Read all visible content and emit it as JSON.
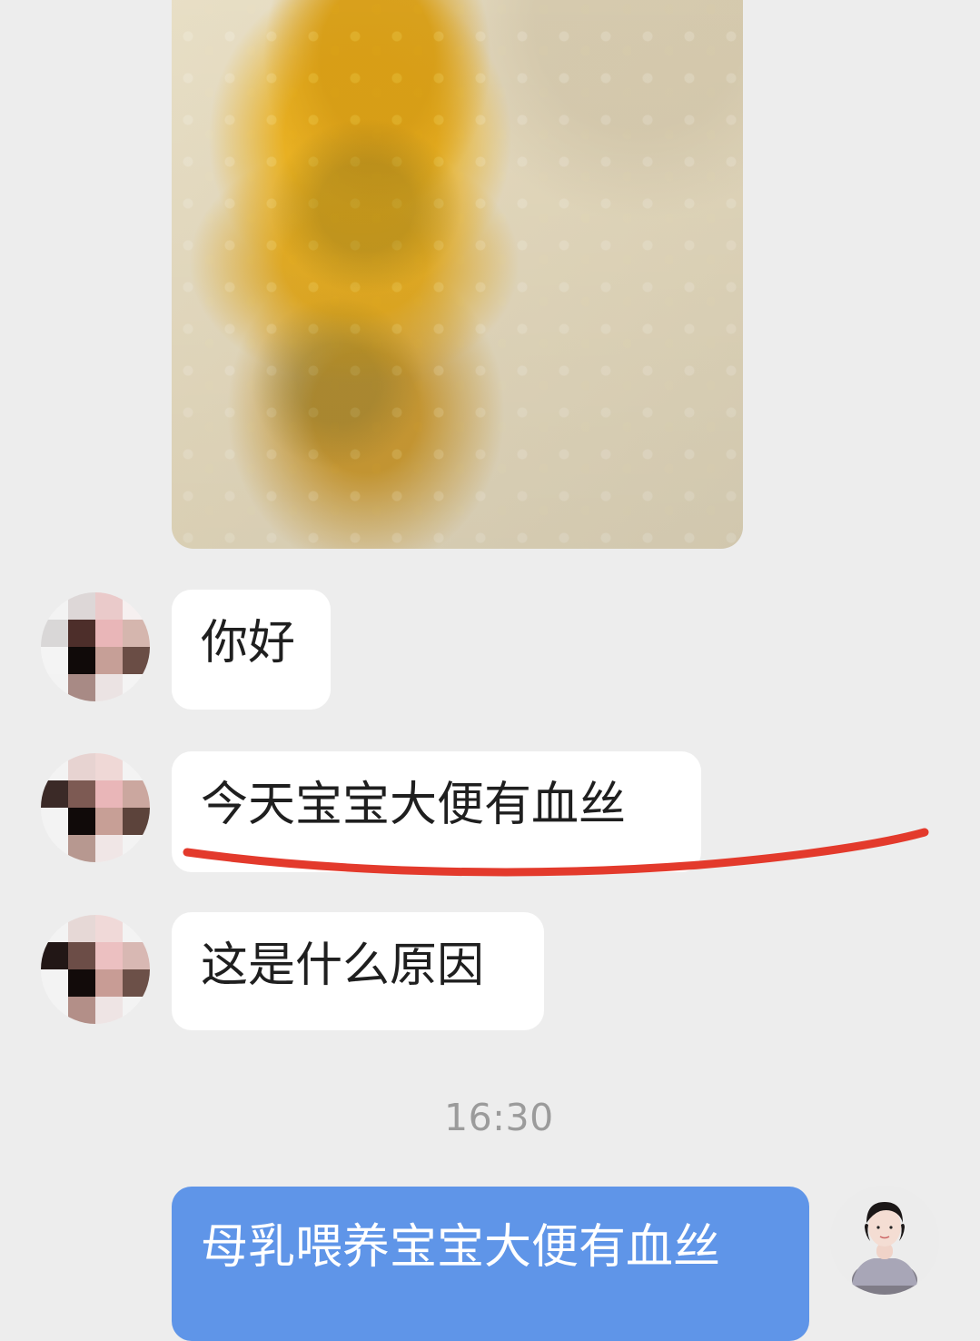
{
  "chat": {
    "messages": [
      {
        "text": "你好"
      },
      {
        "text": "今天宝宝大便有血丝"
      },
      {
        "text": "这是什么原因"
      }
    ],
    "timestamp": "16:30",
    "reply": {
      "text": "母乳喂养宝宝大便有血丝"
    }
  },
  "colors": {
    "background": "#ededed",
    "incoming_bubble": "#ffffff",
    "outgoing_bubble": "#5f95e8",
    "timestamp": "#9b9b9b",
    "annotation": "#e33a2c"
  }
}
